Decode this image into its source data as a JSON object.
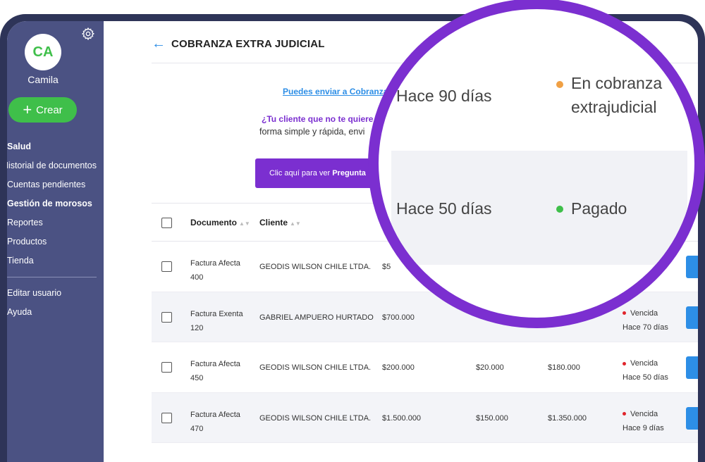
{
  "sidebar": {
    "avatar_initials": "CA",
    "user_name": "Camila",
    "create_label": "Crear",
    "items": [
      {
        "label": "Salud",
        "bold": true
      },
      {
        "label": "Historial de documentos",
        "bold": false
      },
      {
        "label": "Cuentas pendientes",
        "bold": false
      },
      {
        "label": "Gestión de morosos",
        "bold": true
      },
      {
        "label": "Reportes",
        "bold": false
      },
      {
        "label": "Productos",
        "bold": false
      },
      {
        "label": "Tienda",
        "bold": false
      }
    ],
    "bottom_items": [
      {
        "label": "Editar usuario"
      },
      {
        "label": "Ayuda"
      }
    ]
  },
  "header": {
    "title": "COBRANZA EXTRA JUDICIAL"
  },
  "info": {
    "link_text": "Puedes enviar a Cobranza",
    "question": "¿Tu cliente que no te quiere",
    "description": "forma simple y rápida, envi",
    "faq_prefix": "Clic aquí para ver",
    "faq_bold": "Pregunta"
  },
  "table": {
    "columns": {
      "documento": "Documento",
      "cliente": "Cliente"
    },
    "rows": [
      {
        "doc": "Factura Afecta 400",
        "client": "GEODIS WILSON CHILE LTDA.",
        "c1": "$5",
        "c2": "",
        "c3": "",
        "status": "",
        "due": ""
      },
      {
        "doc": "Factura Exenta 120",
        "client": "GABRIEL AMPUERO HURTADO",
        "c1": "$700.000",
        "c2": "",
        "c3": "",
        "status": "Vencida",
        "due": "Hace 70 días"
      },
      {
        "doc": "Factura Afecta 450",
        "client": "GEODIS WILSON CHILE LTDA.",
        "c1": "$200.000",
        "c2": "$20.000",
        "c3": "$180.000",
        "status": "Vencida",
        "due": "Hace 50 días"
      },
      {
        "doc": "Factura Afecta 470",
        "client": "GEODIS WILSON CHILE LTDA.",
        "c1": "$1.500.000",
        "c2": "$150.000",
        "c3": "$1.350.000",
        "status": "Vencida",
        "due": "Hace 9 días"
      }
    ]
  },
  "magnifier": {
    "row1_days": "Hace 90 días",
    "row1_status_line1": "En cobranza",
    "row1_status_line2": "extrajudicial",
    "row1_dot_color": "#f0a044",
    "row2_days": "Hace 50 días",
    "row2_status": "Pagado",
    "row2_dot_color": "#3fbf4a"
  },
  "colors": {
    "sidebar": "#4b5283",
    "accent_green": "#3fbf4a",
    "accent_purple": "#7b2fd0",
    "accent_blue": "#2d8ee6",
    "status_red": "#e0242b"
  }
}
